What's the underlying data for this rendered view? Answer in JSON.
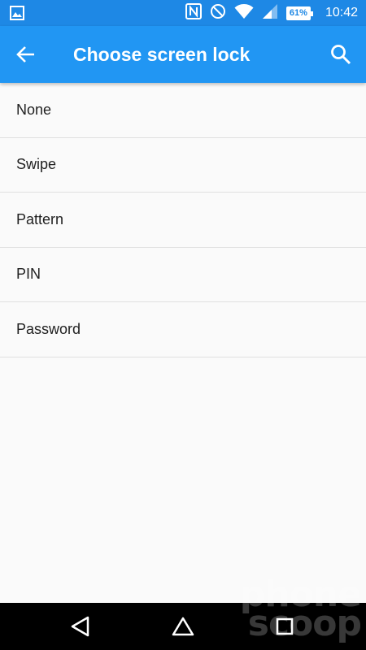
{
  "status_bar": {
    "time": "10:42",
    "battery_percent": "61%",
    "icons": [
      "image-icon",
      "nfc-icon",
      "do-not-disturb-icon",
      "wifi-icon",
      "cell-signal-icon",
      "battery-icon"
    ]
  },
  "app_bar": {
    "title": "Choose screen lock",
    "back_icon": "arrow-back-icon",
    "search_icon": "search-icon",
    "color": "#2196f3"
  },
  "options": [
    {
      "label": "None"
    },
    {
      "label": "Swipe"
    },
    {
      "label": "Pattern"
    },
    {
      "label": "PIN"
    },
    {
      "label": "Password"
    }
  ],
  "nav_bar": {
    "icons": [
      "nav-back-icon",
      "nav-home-icon",
      "nav-recents-icon"
    ]
  },
  "watermark": {
    "line1": "phone",
    "line2": "scoop"
  }
}
